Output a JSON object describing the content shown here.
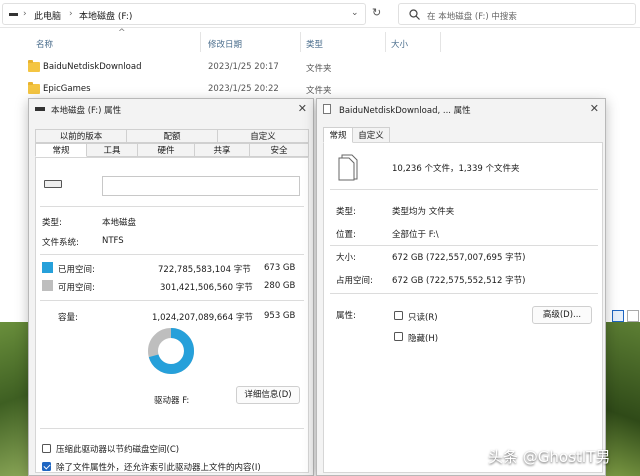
{
  "explorer": {
    "breadcrumb": [
      "此电脑",
      "本地磁盘 (F:)"
    ],
    "search_placeholder": "在 本地磁盘 (F:) 中搜索",
    "columns": {
      "name": "名称",
      "modified": "修改日期",
      "type": "类型",
      "size": "大小"
    },
    "rows": [
      {
        "name": "BaiduNetdiskDownload",
        "date": "2023/1/25 20:17",
        "type": "文件夹"
      },
      {
        "name": "EpicGames",
        "date": "2023/1/25 20:22",
        "type": "文件夹"
      }
    ]
  },
  "drive_dialog": {
    "title": "本地磁盘 (F:) 属性",
    "tabs_row1": [
      "以前的版本",
      "配额",
      "自定义"
    ],
    "tabs_row2": [
      "常规",
      "工具",
      "硬件",
      "共享",
      "安全"
    ],
    "type_label": "类型:",
    "type_value": "本地磁盘",
    "fs_label": "文件系统:",
    "fs_value": "NTFS",
    "used_label": "已用空间:",
    "used_bytes": "722,785,583,104 字节",
    "used_gb": "673 GB",
    "free_label": "可用空间:",
    "free_bytes": "301,421,506,560 字节",
    "free_gb": "280 GB",
    "cap_label": "容量:",
    "cap_bytes": "1,024,207,089,664 字节",
    "cap_gb": "953 GB",
    "drive_label": "驱动器 F:",
    "details_button": "详细信息(D)",
    "compress_label": "压缩此驱动器以节约磁盘空间(C)",
    "index_label": "除了文件属性外，还允许索引此驱动器上文件的内容(I)",
    "used_fraction": 0.706,
    "colors": {
      "used": "#26a0da",
      "free": "#bebebe"
    }
  },
  "folder_dialog": {
    "title": "BaiduNetdiskDownload, ... 属性",
    "tabs": [
      "常规",
      "自定义"
    ],
    "contents": "10,236 个文件，1,339 个文件夹",
    "type_label": "类型:",
    "type_value": "类型均为 文件夹",
    "loc_label": "位置:",
    "loc_value": "全部位于 F:\\",
    "size_label": "大小:",
    "size_value": "672 GB (722,557,007,695 字节)",
    "disk_label": "占用空间:",
    "disk_value": "672 GB (722,575,552,512 字节)",
    "attr_label": "属性:",
    "readonly_label": "只读(R)",
    "hidden_label": "隐藏(H)",
    "advanced_button": "高级(D)..."
  },
  "watermark": "头条 @GhostIT男"
}
